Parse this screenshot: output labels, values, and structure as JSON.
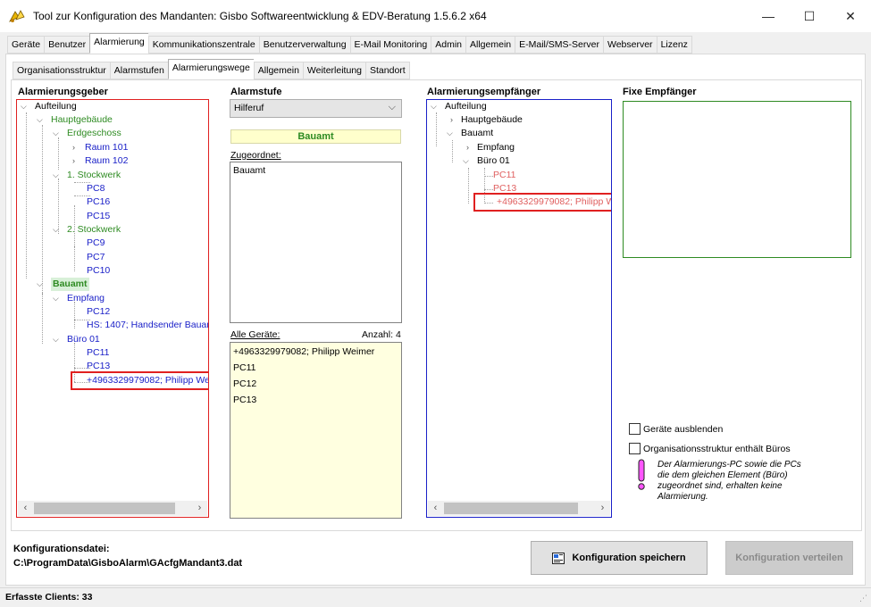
{
  "window": {
    "title": "Tool zur Konfiguration des Mandanten: Gisbo Softwareentwicklung & EDV-Beratung 1.5.6.2 x64",
    "minimize": "—",
    "maximize": "☐",
    "close": "✕"
  },
  "main_tabs": [
    "Geräte",
    "Benutzer",
    "Alarmierung",
    "Kommunikationszentrale",
    "Benutzerverwaltung",
    "E-Mail Monitoring",
    "Admin",
    "Allgemein",
    "E-Mail/SMS-Server",
    "Webserver",
    "Lizenz"
  ],
  "main_tab_active": "Alarmierung",
  "sub_tabs": [
    "Organisationsstruktur",
    "Alarmstufen",
    "Alarmierungswege",
    "Allgemein",
    "Weiterleitung",
    "Standort"
  ],
  "sub_tab_active": "Alarmierungswege",
  "alarmierungsgeber": {
    "label": "Alarmierungsgeber",
    "nodes": {
      "aufteilung": "Aufteilung",
      "hauptgebaeude": "Hauptgebäude",
      "erdgeschoss": "Erdgeschoss",
      "raum101": "Raum 101",
      "raum102": "Raum 102",
      "stockwerk1": "1. Stockwerk",
      "pc8": "PC8",
      "pc16": "PC16",
      "pc15": "PC15",
      "stockwerk2": "2. Stockwerk",
      "pc9": "PC9",
      "pc7": "PC7",
      "pc10": "PC10",
      "bauamt": "Bauamt",
      "empfang": "Empfang",
      "pc12": "PC12",
      "hs1407": "HS: 1407; Handsender Bauam",
      "buero01": "Büro 01",
      "pc11": "PC11",
      "pc13": "PC13",
      "phone": "+4963329979082; Philipp We"
    }
  },
  "alarmstufe": {
    "label": "Alarmstufe",
    "selected": "Hilferuf",
    "banner": "Bauamt",
    "zugeordnet_label": "Zugeordnet:",
    "zugeordnet_items": [
      "Bauamt"
    ],
    "alle_geraete_label": "Alle Geräte:",
    "anzahl_label": "Anzahl: 4",
    "alle_geraete_items": [
      "+4963329979082; Philipp Weimer",
      "PC11",
      "PC12",
      "PC13"
    ]
  },
  "alarmierungsempfaenger": {
    "label": "Alarmierungsempfänger",
    "nodes": {
      "aufteilung": "Aufteilung",
      "hauptgebaeude": "Hauptgebäude",
      "bauamt": "Bauamt",
      "empfang": "Empfang",
      "buero01": "Büro 01",
      "pc11": "PC11",
      "pc13": "PC13",
      "phone": "+4963329979082; Philipp W"
    }
  },
  "fixe_empfaenger": {
    "label": "Fixe Empfänger"
  },
  "options": {
    "geraete_ausblenden": "Geräte ausblenden",
    "org_enthaelt_bueros": "Organisationsstruktur enthält Büros",
    "note": "Der Alarmierungs-PC sowie die PCs die dem gleichen Element (Büro) zugeordnet sind, erhalten keine Alarmierung."
  },
  "footer": {
    "konfig_label": "Konfigurationsdatei:",
    "konfig_path": "C:\\ProgramData\\GisboAlarm\\GAcfgMandant3.dat",
    "save_button": "Konfiguration speichern",
    "distribute_button": "Konfiguration verteilen",
    "status": "Erfasste Clients: 33"
  },
  "colors": {
    "giver_border": "#e02020",
    "receiver_border": "#1a20c8",
    "fixed_border": "#2e8b22",
    "tree_green": "#2e8b22",
    "tree_blue": "#1a20c8",
    "tree_red": "#e06060",
    "banner_bg": "#ffffcc"
  }
}
